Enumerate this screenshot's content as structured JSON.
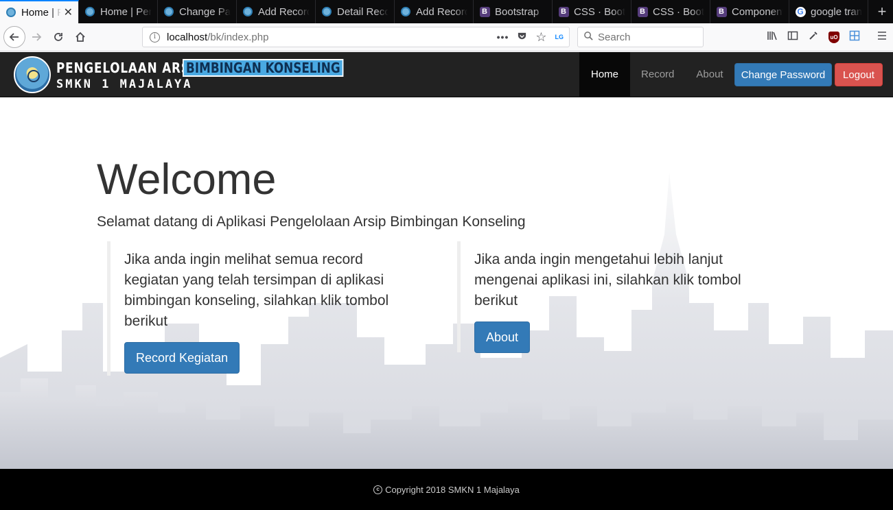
{
  "browser": {
    "tabs": [
      {
        "label": "Home | Pengelolaan",
        "favicon": "seal-icon",
        "active": true
      },
      {
        "label": "Home | Pengelolaan",
        "favicon": "seal-icon"
      },
      {
        "label": "Change Password",
        "favicon": "seal-icon"
      },
      {
        "label": "Add Record",
        "favicon": "seal-icon"
      },
      {
        "label": "Detail Record",
        "favicon": "seal-icon"
      },
      {
        "label": "Add Record",
        "favicon": "seal-icon"
      },
      {
        "label": "Bootstrap",
        "favicon": "bootstrap-icon"
      },
      {
        "label": "CSS · Bootstrap",
        "favicon": "bootstrap-icon"
      },
      {
        "label": "CSS · Bootstrap",
        "favicon": "bootstrap-icon"
      },
      {
        "label": "Components",
        "favicon": "bootstrap-icon"
      },
      {
        "label": "google translate",
        "favicon": "google-icon"
      }
    ],
    "url_host": "localhost",
    "url_path": "/bk/index.php",
    "search_placeholder": "Search"
  },
  "site": {
    "brand": {
      "title": "PENGELOLAAN ARSIP",
      "highlight": "BIMBINGAN KONSELING",
      "school": "SMKN 1 MAJALAYA"
    },
    "nav": [
      {
        "label": "Home",
        "active": true
      },
      {
        "label": "Record"
      },
      {
        "label": "About"
      }
    ],
    "change_password_label": "Change Password",
    "logout_label": "Logout"
  },
  "main": {
    "heading": "Welcome",
    "subtitle": "Selamat datang di Aplikasi Pengelolaan Arsip Bimbingan Konseling",
    "left": {
      "text": "Jika anda ingin melihat semua record kegiatan yang telah tersimpan di aplikasi bimbingan konseling, silahkan klik tombol berikut",
      "button": "Record Kegiatan"
    },
    "right": {
      "text": "Jika anda ingin mengetahui lebih lanjut mengenai aplikasi ini, silahkan klik tombol berikut",
      "button": "About"
    }
  },
  "footer": {
    "copyright": "Copyright 2018 SMKN 1 Majalaya"
  },
  "colors": {
    "navbar": "#222222",
    "primary": "#337ab7",
    "danger": "#d9534f",
    "footer": "#000000"
  }
}
